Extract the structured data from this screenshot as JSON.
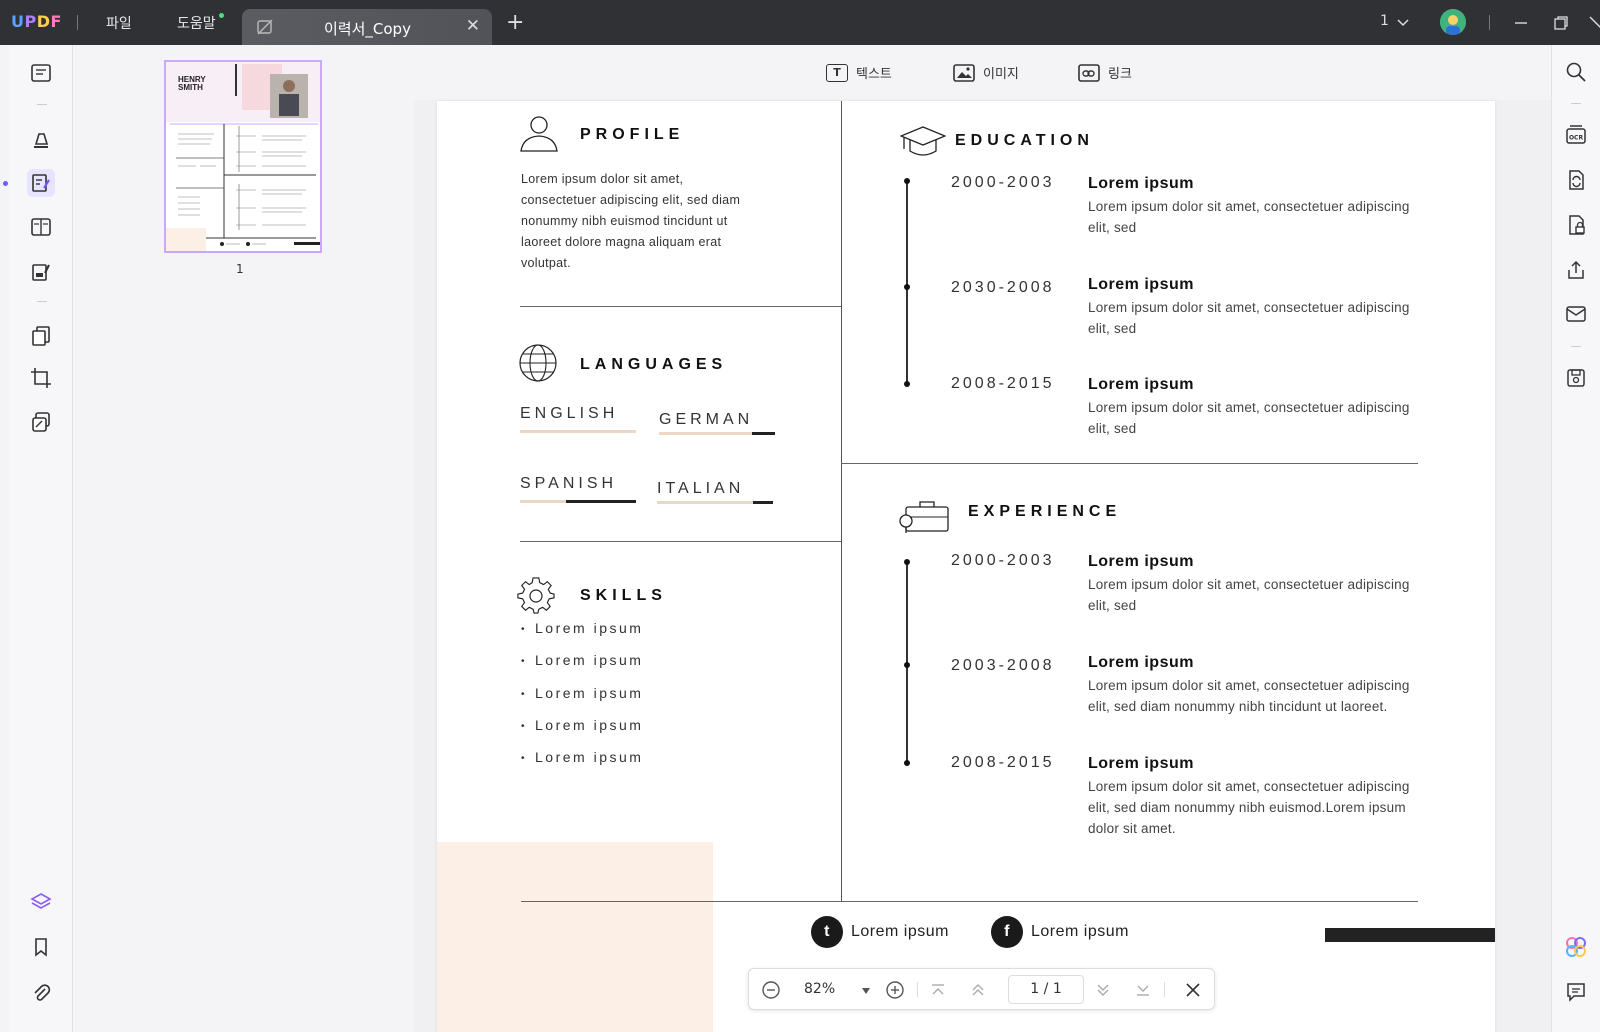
{
  "app": {
    "logo": "UPDF"
  },
  "menu": {
    "file": "파일",
    "help": "도움말"
  },
  "tab": {
    "title": "이력서_Copy",
    "close": "✕"
  },
  "titlebar": {
    "new_tab": "+",
    "page_indicator": "1"
  },
  "edit_toolbar": {
    "text": "텍스트",
    "image": "이미지",
    "link": "링크"
  },
  "thumbnail": {
    "page_number": "1"
  },
  "resume": {
    "profile": {
      "title": "PROFILE",
      "text": "Lorem ipsum dolor sit amet, consectetuer adipiscing elit, sed diam nonummy nibh euismod tincidunt ut laoreet dolore magna aliquam erat volutpat."
    },
    "languages": {
      "title": "LANGUAGES",
      "items": [
        {
          "name": "ENGLISH",
          "level": 1.0
        },
        {
          "name": "GERMAN",
          "level": 0.8
        },
        {
          "name": "SPANISH",
          "level": 0.4
        },
        {
          "name": "ITALIAN",
          "level": 0.83
        }
      ]
    },
    "skills": {
      "title": "SKILLS",
      "items": [
        "Lorem ipsum",
        "Lorem ipsum",
        "Lorem ipsum",
        "Lorem ipsum",
        "Lorem ipsum"
      ]
    },
    "education": {
      "title": "EDUCATION",
      "entries": [
        {
          "years": "2000-2003",
          "title": "Lorem ipsum",
          "desc": "Lorem ipsum dolor sit amet, consectetuer adipiscing elit, sed"
        },
        {
          "years": "2030-2008",
          "title": "Lorem ipsum",
          "desc": "Lorem ipsum dolor sit amet, consectetuer adipiscing elit, sed"
        },
        {
          "years": "2008-2015",
          "title": "Lorem ipsum",
          "desc": "Lorem ipsum dolor sit amet, consectetuer adipiscing elit, sed"
        }
      ]
    },
    "experience": {
      "title": "EXPERIENCE",
      "entries": [
        {
          "years": "2000-2003",
          "title": "Lorem ipsum",
          "desc": "Lorem ipsum dolor sit amet, consectetuer adipiscing elit, sed"
        },
        {
          "years": "2003-2008",
          "title": "Lorem ipsum",
          "desc": "Lorem ipsum dolor sit amet, consectetuer adipiscing elit, sed diam nonummy nibh tincidunt ut laoreet."
        },
        {
          "years": "2008-2015",
          "title": "Lorem ipsum",
          "desc": "Lorem ipsum dolor sit amet, consectetuer adipiscing elit, sed diam nonummy nibh euismod.Lorem ipsum dolor sit amet."
        }
      ]
    },
    "social": {
      "twitter": "Lorem ipsum",
      "facebook": "Lorem ipsum",
      "twitter_glyph": "t",
      "facebook_glyph": "f"
    }
  },
  "thumb_text": {
    "name_line1": "HENRY",
    "name_line2": "SMITH"
  },
  "navbar": {
    "zoom": "82%",
    "page_current": "1",
    "page_total": "1",
    "page_separator": "/"
  },
  "colors": {
    "accent": "#6d5cff",
    "peach": "#fcefe6",
    "titlebar": "#2f3135",
    "thumb_border": "#c9a8ff"
  }
}
